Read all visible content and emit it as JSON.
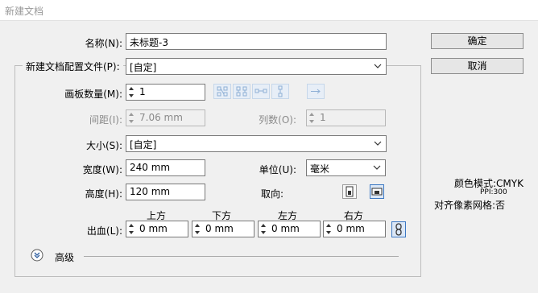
{
  "window": {
    "title": "新建文档"
  },
  "name": {
    "label": "名称(N):",
    "value": "未标题-3"
  },
  "profile": {
    "label": "新建文档配置文件(P):",
    "value": "[自定]"
  },
  "artboards": {
    "count_label": "画板数量(M):",
    "count_value": "1",
    "spacing_label": "间距(I):",
    "spacing_value": "7.06 mm",
    "columns_label": "列数(O):",
    "columns_value": "1"
  },
  "size": {
    "label": "大小(S):",
    "value": "[自定]"
  },
  "width": {
    "label": "宽度(W):",
    "value": "240 mm"
  },
  "height": {
    "label": "高度(H):",
    "value": "120 mm"
  },
  "units": {
    "label": "单位(U):",
    "value": "毫米"
  },
  "orientation": {
    "label": "取向:"
  },
  "bleed": {
    "label": "出血(L):",
    "top_label": "上方",
    "top_value": "0 mm",
    "bottom_label": "下方",
    "bottom_value": "0 mm",
    "left_label": "左方",
    "left_value": "0 mm",
    "right_label": "右方",
    "right_value": "0 mm"
  },
  "advanced": {
    "label": "高级"
  },
  "buttons": {
    "ok": "确定",
    "cancel": "取消"
  },
  "info": {
    "color_mode": "颜色模式:CMYK",
    "ppi": "PPI:300",
    "pixel_align": "对齐像素网格:否"
  }
}
